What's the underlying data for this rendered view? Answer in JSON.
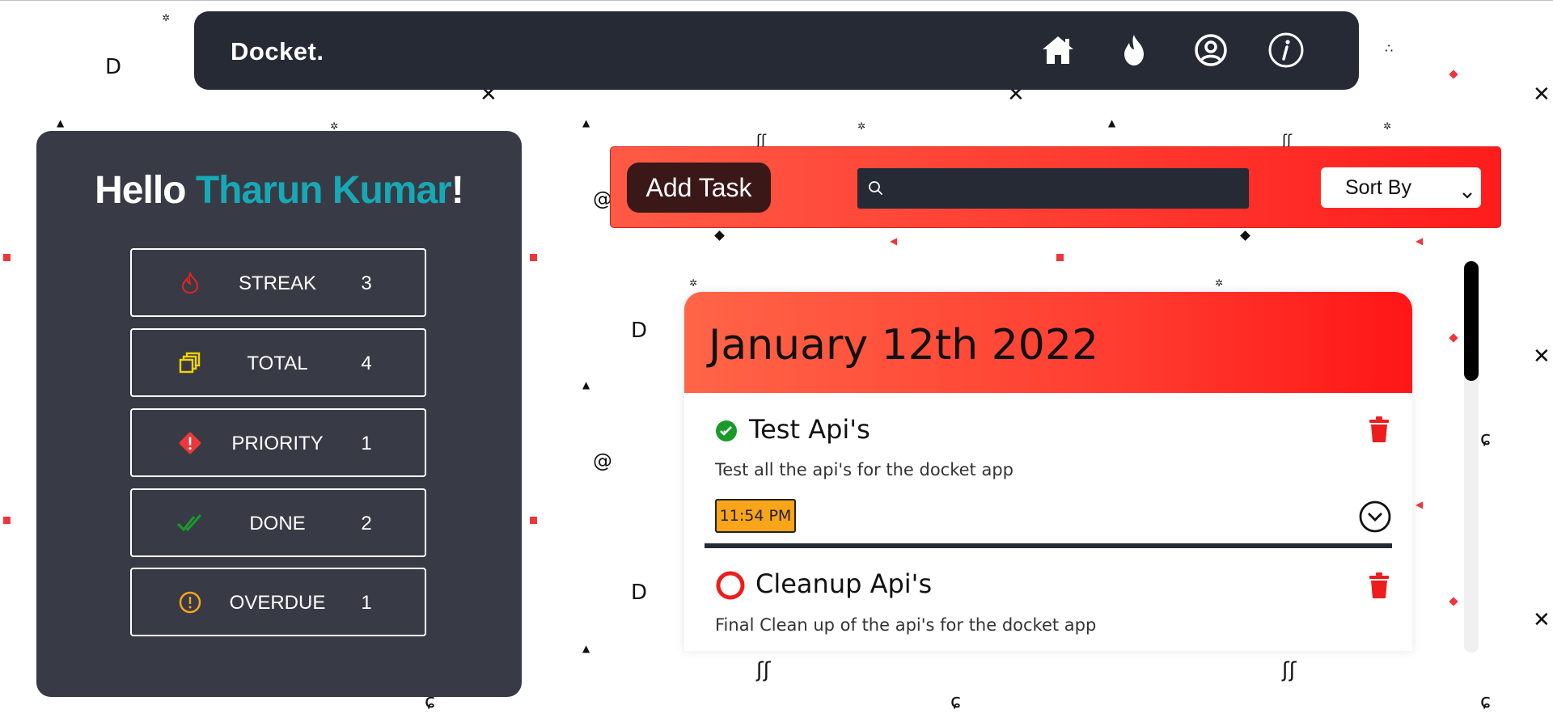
{
  "navbar": {
    "brand": "Docket.",
    "icons": [
      "home-icon",
      "flame-icon",
      "user-circle-icon",
      "info-icon"
    ]
  },
  "user": {
    "greeting_prefix": "Hello ",
    "name": "Tharun Kumar",
    "greeting_suffix": "!"
  },
  "stats": [
    {
      "label": "STREAK",
      "value": "3",
      "icon": "flame-outline-icon",
      "color": "#e02424"
    },
    {
      "label": "TOTAL",
      "value": "4",
      "icon": "stacked-squares-icon",
      "color": "#f5d300"
    },
    {
      "label": "PRIORITY",
      "value": "1",
      "icon": "warning-diamond-icon",
      "color": "#f0363a"
    },
    {
      "label": "DONE",
      "value": "2",
      "icon": "double-check-icon",
      "color": "#1a9a2a"
    },
    {
      "label": "OVERDUE",
      "value": "1",
      "icon": "alert-circle-icon",
      "color": "#f9a51a"
    }
  ],
  "toolbar": {
    "add_task_label": "Add Task",
    "search_placeholder": "",
    "sort_label": "Sort By"
  },
  "date_group": {
    "date": "January 12th 2022",
    "tasks": [
      {
        "title": "Test Api's",
        "description": "Test all the api's for the docket app",
        "time": "11:54 PM",
        "status": "done"
      },
      {
        "title": "Cleanup Api's",
        "description": "Final Clean up of the api's for the docket app",
        "status": "pending"
      }
    ]
  },
  "colors": {
    "navbar": "#262a35",
    "panel": "#383b45",
    "accent_name": "#16a9b5",
    "toolbar_red": "#ff2a2a",
    "time_badge": "#f9a51a"
  }
}
